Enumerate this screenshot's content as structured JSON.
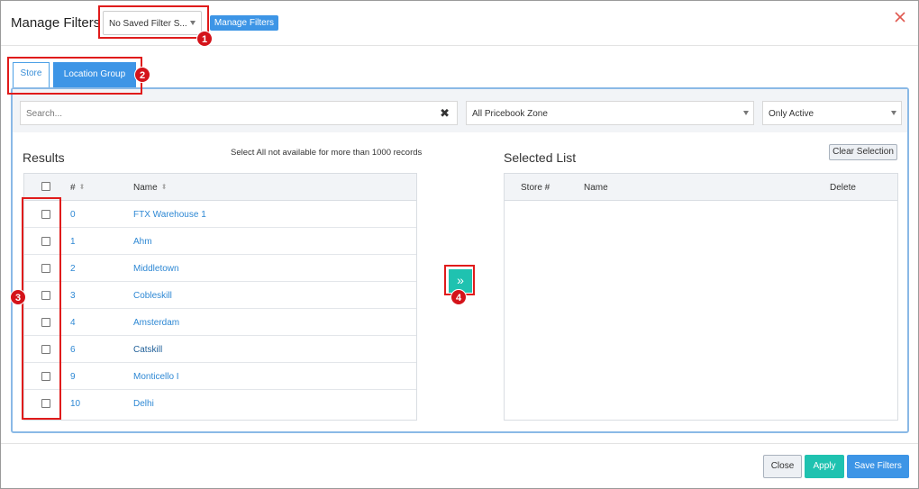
{
  "header": {
    "title": "Manage Filters",
    "saved_filter_value": "No Saved Filter S...",
    "manage_filters_label": "Manage Filters",
    "close_icon": "close-icon",
    "close_color": "#e0584f"
  },
  "tabs": [
    {
      "label": "Store"
    },
    {
      "label": "Location Group"
    }
  ],
  "filters": {
    "search_placeholder": "Search...",
    "search_clear_glyph": "✖",
    "zone_value": "All Pricebook Zone",
    "status_value": "Only Active"
  },
  "results": {
    "title": "Results",
    "note": "Select All not available for more than 1000 records",
    "columns": [
      "#",
      "Name"
    ],
    "rows": [
      {
        "num": "0",
        "name": "FTX Warehouse 1"
      },
      {
        "num": "1",
        "name": "Ahm"
      },
      {
        "num": "2",
        "name": "Middletown"
      },
      {
        "num": "3",
        "name": "Cobleskill"
      },
      {
        "num": "4",
        "name": "Amsterdam"
      },
      {
        "num": "6",
        "name": "Catskill"
      },
      {
        "num": "9",
        "name": "Monticello I"
      },
      {
        "num": "10",
        "name": "Delhi"
      }
    ]
  },
  "move_button_glyph": "»",
  "selected": {
    "title": "Selected List",
    "clear_label": "Clear Selection",
    "columns": [
      "Store #",
      "Name",
      "Delete"
    ]
  },
  "footer": {
    "close_label": "Close",
    "apply_label": "Apply",
    "save_label": "Save Filters"
  },
  "callouts": [
    "1",
    "2",
    "3",
    "4"
  ],
  "colors": {
    "primary_blue": "#3d95e6",
    "teal": "#1fc2b0",
    "callout_red": "#d4131a",
    "link_blue": "#2e88d4"
  }
}
